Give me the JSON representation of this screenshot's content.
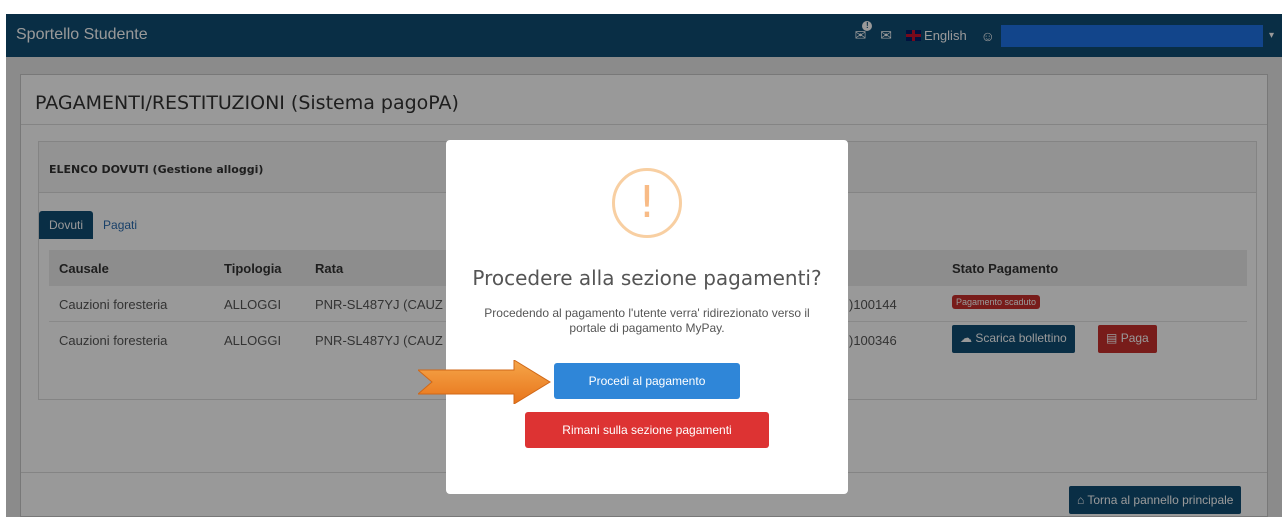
{
  "navbar": {
    "brand": "Sportello Studente",
    "notifications_icon": "chat-bubble-icon",
    "mail_icon": "envelope-icon",
    "language": "English",
    "user_icon": "user-icon",
    "caret": "▾"
  },
  "page": {
    "title": "PAGAMENTI/RESTITUZIONI (Sistema pagoPA)",
    "section_title": "ELENCO DOVUTI (Gestione alloggi)",
    "tabs": [
      {
        "label": "Dovuti",
        "active": true
      },
      {
        "label": "Pagati",
        "active": false
      }
    ],
    "table": {
      "headers": [
        "Causale",
        "Tipologia",
        "Rata",
        "Stato Pagamento"
      ],
      "rows": [
        {
          "causale": "Cauzioni foresteria",
          "tipologia": "ALLOGGI",
          "rata": "PNR-SL487YJ (CAUZ",
          "code": ")100144",
          "stato": "Pagamento scaduto"
        },
        {
          "causale": "Cauzioni foresteria",
          "tipologia": "ALLOGGI",
          "rata": "PNR-SL487YJ (CAUZ",
          "code": ")100346",
          "download_label": "Scarica bollettino",
          "pay_label": "Paga"
        }
      ]
    },
    "back_button": "Torna al pannello principale"
  },
  "modal": {
    "icon": "!",
    "title": "Procedere alla sezione pagamenti?",
    "text": "Procedendo al pagamento l'utente verra' ridirezionato verso il portale di pagamento MyPay.",
    "confirm_label": "Procedi al pagamento",
    "cancel_label": "Rimani sulla sezione pagamenti"
  },
  "colors": {
    "navbar": "#0f4d74",
    "confirm": "#2f86d8",
    "cancel": "#dd3333",
    "warning": "#f8bb86",
    "arrow": "#f08a24"
  }
}
